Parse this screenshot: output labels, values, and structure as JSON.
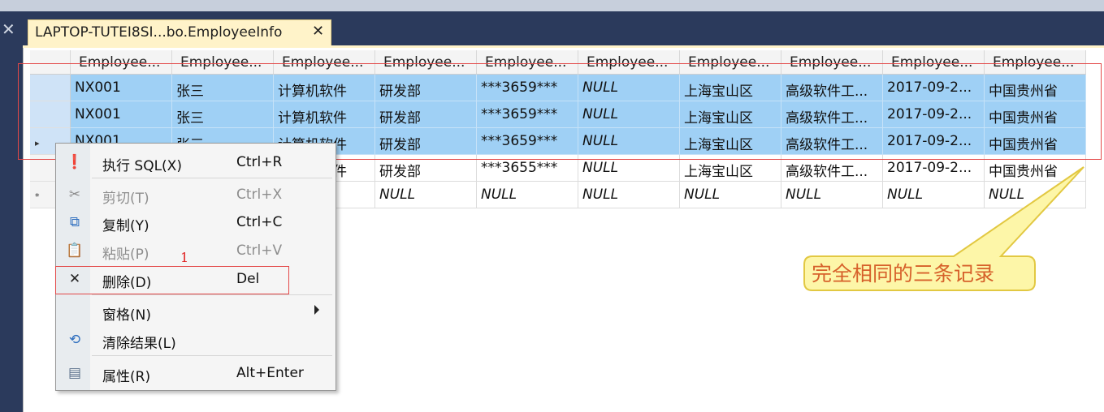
{
  "tab": {
    "title": "LAPTOP-TUTEI8SI...bo.EmployeeInfo",
    "close": "✕"
  },
  "left_close": "✕",
  "grid": {
    "headers": [
      "Employee...",
      "Employee...",
      "Employee...",
      "Employee...",
      "Employee...",
      "Employee...",
      "Employee...",
      "Employee...",
      "Employee...",
      "Employee..."
    ],
    "rows": [
      {
        "selected": true,
        "marker": "",
        "cells": [
          "NX001",
          "张三",
          "计算机软件",
          "研发部",
          "***3659***",
          "NULL",
          "上海宝山区",
          "高级软件工...",
          "2017-09-2...",
          "中国贵州省"
        ]
      },
      {
        "selected": true,
        "marker": "",
        "cells": [
          "NX001",
          "张三",
          "计算机软件",
          "研发部",
          "***3659***",
          "NULL",
          "上海宝山区",
          "高级软件工...",
          "2017-09-2...",
          "中国贵州省"
        ]
      },
      {
        "selected": true,
        "marker": "▸",
        "cells": [
          "NX001",
          "张三",
          "计算机软件",
          "研发部",
          "***3659***",
          "NULL",
          "上海宝山区",
          "高级软件工...",
          "2017-09-2...",
          "中国贵州省"
        ]
      },
      {
        "selected": false,
        "marker": "",
        "cells": [
          "",
          "",
          "计算机软件",
          "研发部",
          "***3655***",
          "NULL",
          "上海宝山区",
          "高级软件工...",
          "2017-09-2...",
          "中国贵州省"
        ]
      },
      {
        "selected": false,
        "marker": "*",
        "cells": [
          "",
          "",
          "",
          "NULL",
          "NULL",
          "NULL",
          "NULL",
          "NULL",
          "NULL",
          "NULL"
        ]
      }
    ]
  },
  "context_menu": {
    "items": [
      {
        "label": "执行 SQL(X)",
        "shortcut": "Ctrl+R",
        "icon": "execute-icon",
        "glyph": "❗",
        "color": "#c43232",
        "disabled": false
      },
      {
        "label": "剪切(T)",
        "shortcut": "Ctrl+X",
        "icon": "scissors-icon",
        "glyph": "✂",
        "color": "#8a8a8a",
        "disabled": true
      },
      {
        "label": "复制(Y)",
        "shortcut": "Ctrl+C",
        "icon": "copy-icon",
        "glyph": "⧉",
        "color": "#2f6fbf",
        "disabled": false
      },
      {
        "label": "粘贴(P)",
        "shortcut": "Ctrl+V",
        "icon": "paste-icon",
        "glyph": "📋",
        "color": "#8a8a8a",
        "disabled": true
      },
      {
        "label": "删除(D)",
        "shortcut": "Del",
        "icon": "delete-icon",
        "glyph": "✕",
        "color": "#222222",
        "disabled": false
      },
      {
        "label": "窗格(N)",
        "shortcut": "",
        "icon": "",
        "glyph": "",
        "color": "#222222",
        "disabled": false,
        "submenu": true
      },
      {
        "label": "清除结果(L)",
        "shortcut": "",
        "icon": "clear-results-icon",
        "glyph": "⟲",
        "color": "#2f6fbf",
        "disabled": false
      },
      {
        "label": "属性(R)",
        "shortcut": "Alt+Enter",
        "icon": "properties-icon",
        "glyph": "▤",
        "color": "#5a6f8a",
        "disabled": false
      }
    ]
  },
  "annotations": {
    "step_number": "1",
    "callout": "完全相同的三条记录"
  },
  "colors": {
    "selection": "#9fd0f5",
    "annotation_red": "#e34848",
    "callout_fill": "#fdf6a8",
    "callout_text": "#d6602a"
  }
}
